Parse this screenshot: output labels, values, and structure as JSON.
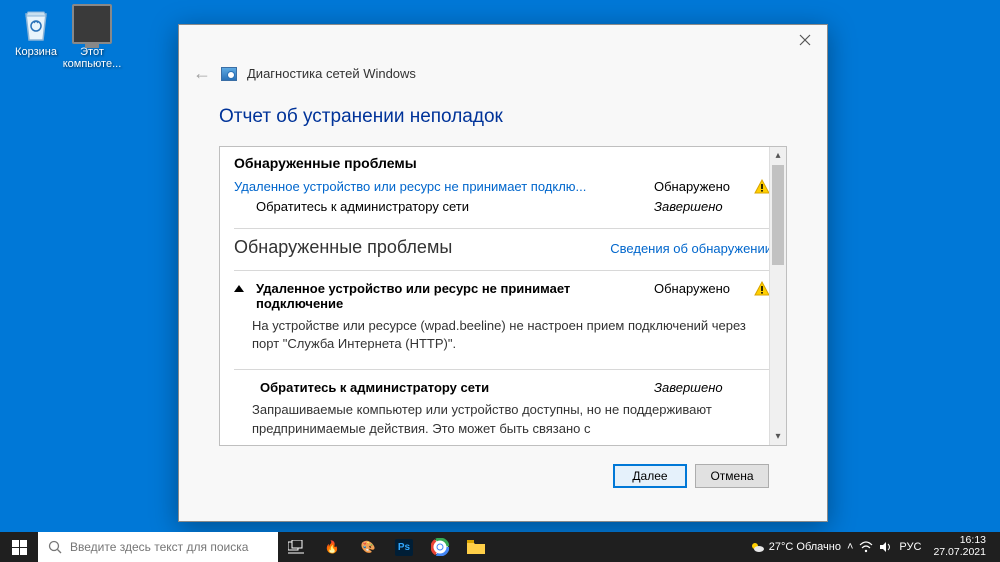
{
  "desktop": {
    "recycle": "Корзина",
    "thispc": "Этот\nкомпьюте..."
  },
  "window": {
    "header": "Диагностика сетей Windows",
    "report_title": "Отчет об устранении неполадок",
    "section1_title": "Обнаруженные проблемы",
    "row1_label": "Удаленное устройство или ресурс не принимает подклю...",
    "row1_status": "Обнаружено",
    "row2_label": "Обратитесь к администратору сети",
    "row2_status": "Завершено",
    "sub_header": "Обнаруженные проблемы",
    "details_link": "Сведения об обнаружении",
    "problem_title": "Удаленное устройство или ресурс не принимает подключение",
    "problem_status": "Обнаружено",
    "problem_desc": "На устройстве или ресурсе (wpad.beeline) не настроен прием подключений через порт \"Служба Интернета (HTTP)\".",
    "step_title": "Обратитесь к администратору сети",
    "step_status": "Завершено",
    "step_desc": "Запрашиваемые компьютер или устройство доступны, но не поддерживают предпринимаемые действия. Это может быть связано с",
    "next": "Далее",
    "cancel": "Отмена"
  },
  "taskbar": {
    "search_placeholder": "Введите здесь текст для поиска",
    "weather": "27°C Облачно",
    "lang": "РУС",
    "time": "16:13",
    "date": "27.07.2021"
  }
}
